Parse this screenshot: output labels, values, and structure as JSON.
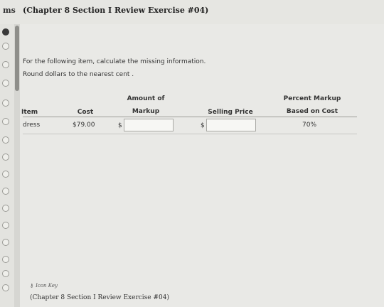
{
  "header": {
    "left_label": "ms",
    "title": "(Chapter 8 Section I Review Exercise #04)"
  },
  "instructions": {
    "line1": "For the following item, calculate the missing information.",
    "line2": "Round dollars to the nearest cent ."
  },
  "table": {
    "headers": {
      "item": "Item",
      "cost": "Cost",
      "markup_line1": "Amount of",
      "markup_line2": "Markup",
      "selling_price": "Selling Price",
      "percent_line1": "Percent Markup",
      "percent_line2": "Based on Cost"
    },
    "row": {
      "item": "dress",
      "cost": "$79.00",
      "markup_prefix": "$",
      "markup_value": "",
      "selling_prefix": "$",
      "selling_value": "",
      "percent": "70%"
    }
  },
  "footer": {
    "icon_key": "Icon Key",
    "title": "(Chapter 8 Section I Review Exercise #04)"
  }
}
